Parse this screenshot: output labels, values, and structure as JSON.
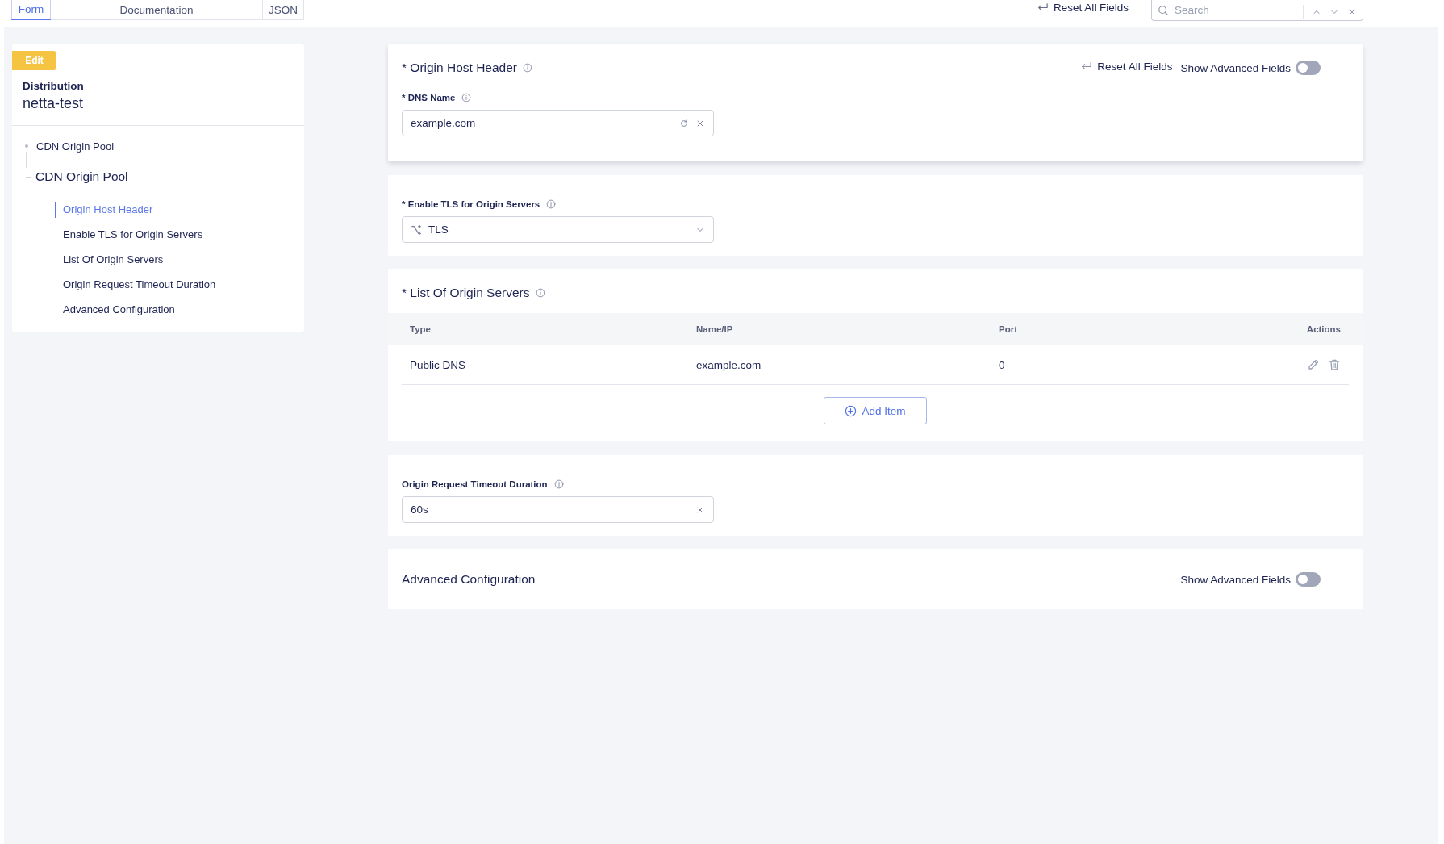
{
  "top_tabs": [
    {
      "label": "Form",
      "selected": true
    },
    {
      "label": "Documentation",
      "selected": false
    },
    {
      "label": "JSON",
      "selected": false
    }
  ],
  "toolbar": {
    "reset_label": "Reset All Fields",
    "search": {
      "placeholder": "Search"
    }
  },
  "sidebar": {
    "badge": "Edit",
    "title": "Distribution",
    "name": "netta-test",
    "tree": [
      {
        "label": "CDN Origin Pool",
        "children": [
          {
            "label": "CDN Origin Pool",
            "children": [
              {
                "label": "Origin Host Header",
                "selected": true
              },
              {
                "label": "Enable TLS for Origin Servers",
                "selected": false
              },
              {
                "label": "List Of Origin Servers",
                "selected": false
              },
              {
                "label": "Origin Request Timeout Duration",
                "selected": false
              },
              {
                "label": "Advanced Configuration",
                "selected": false
              }
            ]
          }
        ]
      }
    ]
  },
  "sections": [
    {
      "title": "* Origin Host Header",
      "info": true,
      "elevated": true,
      "reset_label": "Reset All Fields",
      "toggle": {
        "label": "Show Advanced Fields",
        "on": false
      },
      "field": {
        "kind": "input",
        "label": "* DNS Name",
        "value": "example.com",
        "refresh": true
      }
    },
    {
      "elevated": false,
      "field": {
        "kind": "select",
        "label": "* Enable TLS for Origin Servers",
        "value": "TLS"
      }
    },
    {
      "title": "* List Of Origin Servers",
      "info": true,
      "elevated": false,
      "table": {
        "columns": [
          "Type",
          "Name/IP",
          "Port",
          "Actions"
        ],
        "rows": [
          [
            "Public DNS",
            "example.com",
            "0"
          ]
        ],
        "add_label": "Add Item"
      }
    },
    {
      "elevated": false,
      "field": {
        "kind": "input",
        "label": "Origin Request Timeout Duration",
        "value": "60s",
        "refresh": false
      }
    },
    {
      "title": "Advanced Configuration",
      "info": false,
      "elevated": false,
      "toggle": {
        "label": "Show Advanced Fields",
        "on": false
      }
    }
  ]
}
